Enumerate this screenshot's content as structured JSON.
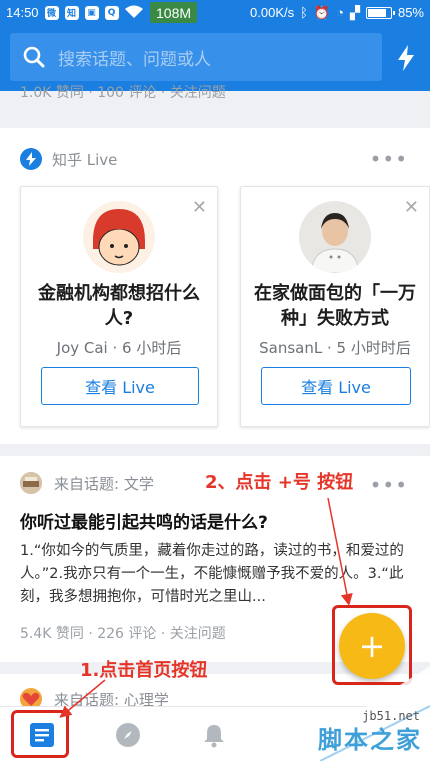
{
  "status_bar": {
    "time": "14:50",
    "net_speed_pill": "108M",
    "speed": "0.00K/s",
    "battery": "85%",
    "battery_level": 0.85
  },
  "search": {
    "placeholder": "搜索话题、问题或人"
  },
  "cutoff_text": "1.0K 赞同 · 100 评论 · 关注问题",
  "live": {
    "title": "知乎 Live",
    "cards": [
      {
        "title": "金融机构都想招什么人?",
        "meta": "Joy Cai · 6 小时后",
        "button": "查看 Live"
      },
      {
        "title": "在家做面包的「一万种」失败方式",
        "meta": "SansanL · 5 小时时后",
        "button": "查看 Live"
      }
    ]
  },
  "feed": {
    "topic": "来自话题: 文学",
    "question": "你听过最能引起共鸣的话是什么?",
    "excerpt": "1.“你如今的气质里，藏着你走过的路，读过的书，和爱过的人。”2.我亦只有一个一生，不能慷慨赠予我不爱的人。3.“此刻，我多想拥抱你，可惜时光之里山...",
    "meta": "5.4K 赞同 · 226 评论 · 关注问题"
  },
  "next_feed": {
    "topic": "来自话题: 心理学"
  },
  "fab": {
    "label": "+"
  },
  "annotations": {
    "step1": "1.点击首页按钮",
    "step2": "2、点击 +号 按钮"
  },
  "watermark": {
    "site": "jb51.net",
    "name": "脚本之家"
  },
  "colors": {
    "brand": "#1a7fe0",
    "fab": "#f6b916",
    "annotation": "#e53529"
  }
}
